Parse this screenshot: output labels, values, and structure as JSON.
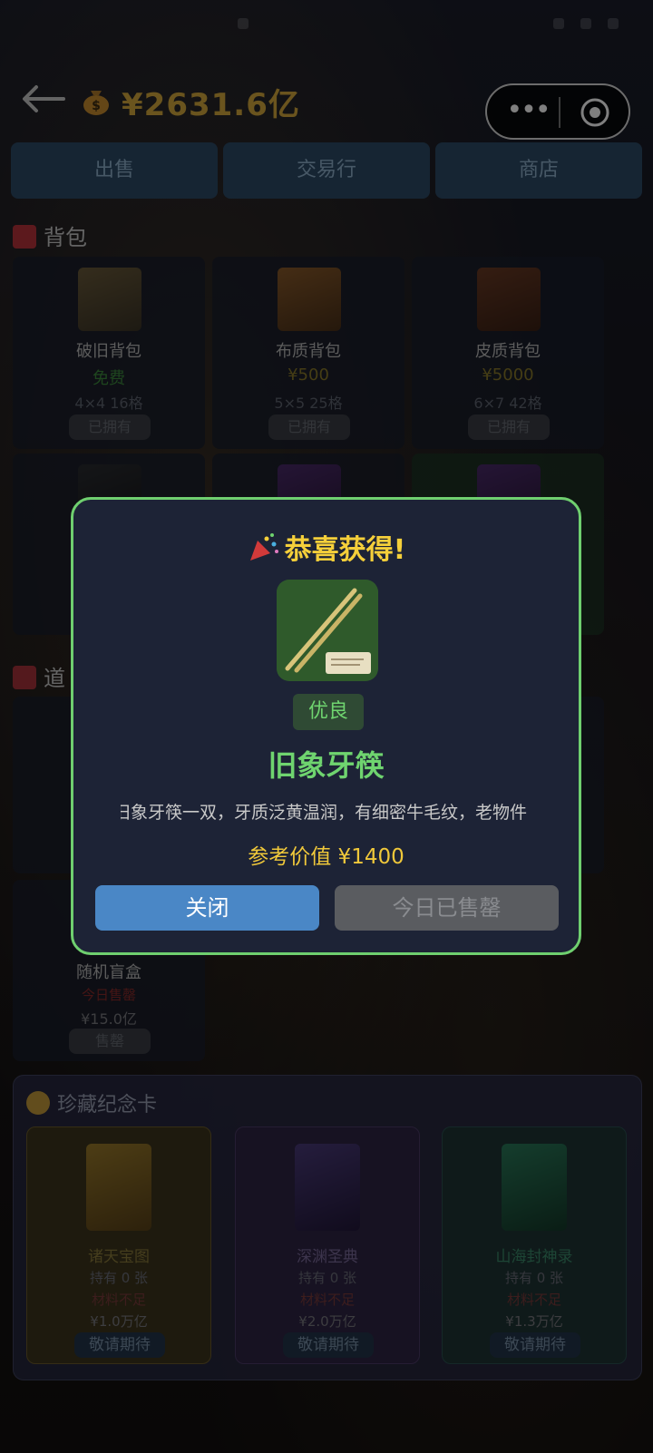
{
  "header": {
    "balance": "¥2631.6亿"
  },
  "tabs": [
    {
      "label": "出售"
    },
    {
      "label": "交易行"
    },
    {
      "label": "商店"
    }
  ],
  "backpack_section": {
    "title": "背包",
    "items": [
      {
        "name": "破旧背包",
        "price": "免费",
        "size": "4×4 16格",
        "status": "已拥有"
      },
      {
        "name": "布质背包",
        "price": "¥500",
        "size": "5×5 25格",
        "status": "已拥有"
      },
      {
        "name": "皮质背包",
        "price": "¥5000",
        "size": "6×7 42格",
        "status": "已拥有"
      }
    ]
  },
  "tools_section": {
    "title": "道"
  },
  "blind_box": {
    "name": "随机盲盒",
    "status": "今日售罄",
    "price": "¥15.0亿",
    "button": "售罄"
  },
  "collection": {
    "title": "珍藏纪念卡",
    "cards": [
      {
        "name": "诸天宝图",
        "held": "持有 0 张",
        "material": "材料不足",
        "price": "¥1.0万亿",
        "button": "敬请期待"
      },
      {
        "name": "深渊圣典",
        "held": "持有 0 张",
        "material": "材料不足",
        "price": "¥2.0万亿",
        "button": "敬请期待"
      },
      {
        "name": "山海封神录",
        "held": "持有 0 张",
        "material": "材料不足",
        "price": "¥1.3万亿",
        "button": "敬请期待"
      }
    ]
  },
  "modal": {
    "title": "恭喜获得!",
    "rarity": "优良",
    "item_name": "旧象牙筷",
    "description": "旧象牙筷一双，牙质泛黄温润，有细密牛毛纹，老物件",
    "value": "参考价值 ¥1400",
    "close_label": "关闭",
    "sold_out_label": "今日已售罄"
  },
  "colors": {
    "accent_gold": "#d4a93c",
    "success_green": "#6fd46f",
    "modal_border": "#6fcf6f",
    "button_blue": "#4a87c6"
  }
}
